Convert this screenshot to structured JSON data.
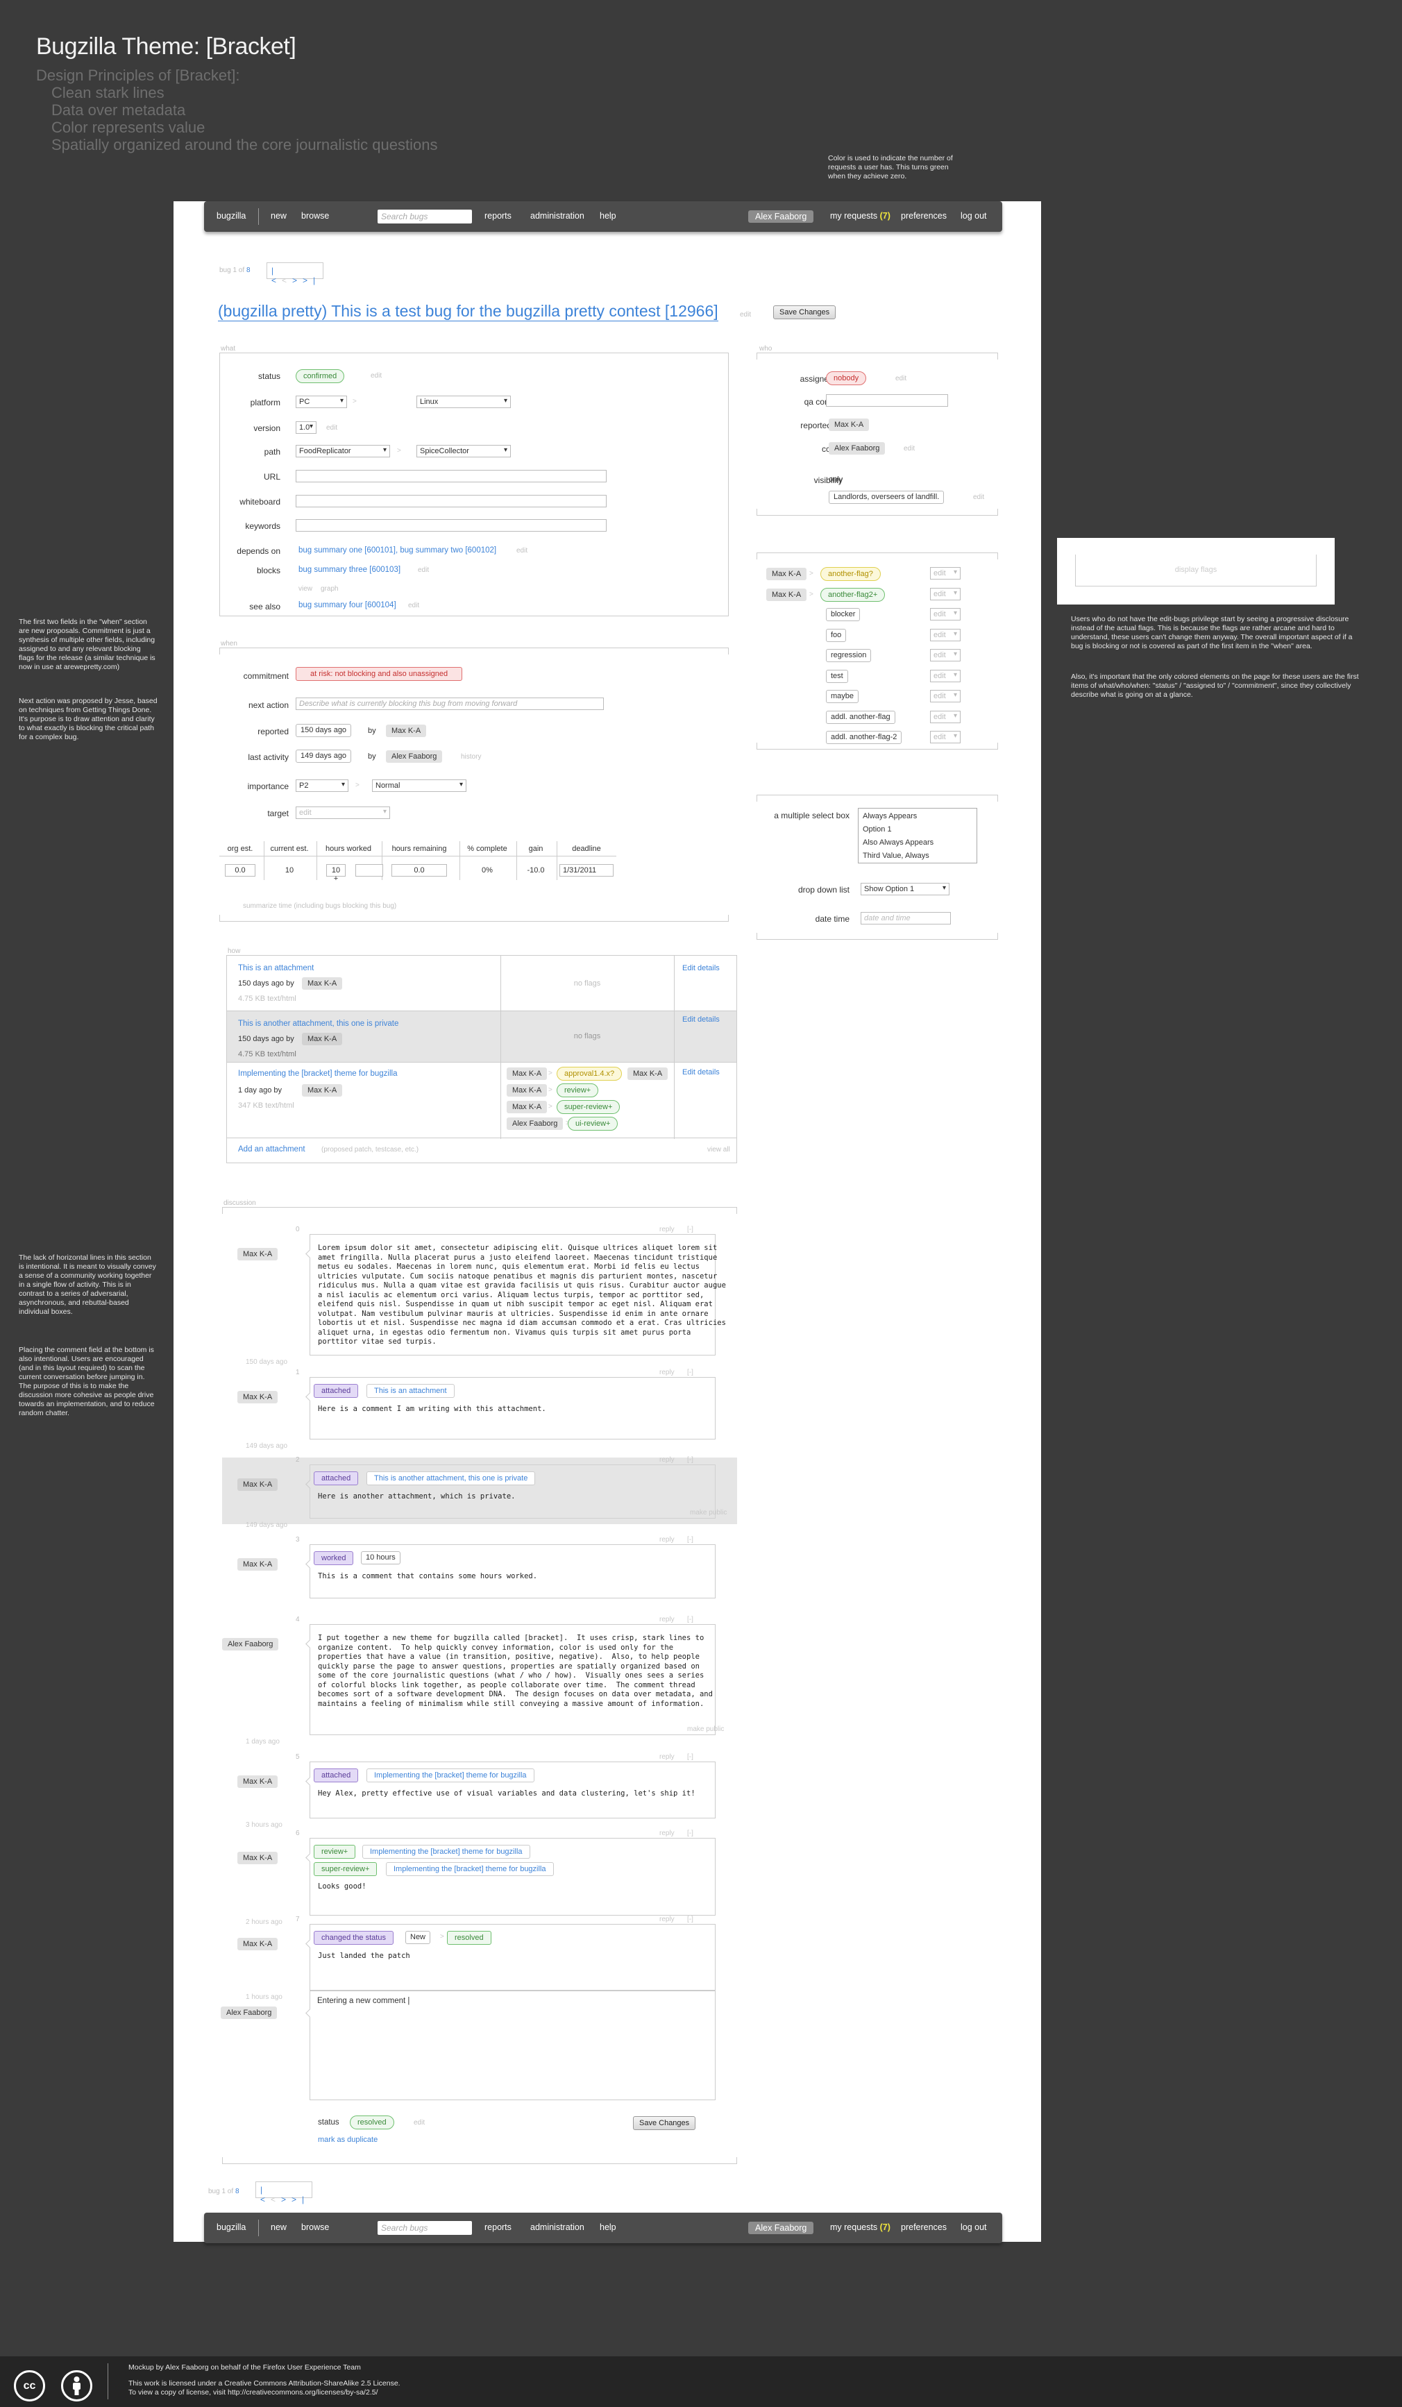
{
  "doc_title": "Bugzilla Theme: [Bracket]",
  "principles": {
    "heading": "Design Principles of [Bracket]:",
    "items": [
      "Clean stark lines",
      "Data over metadata",
      "Color represents value",
      "Spatially organized around the core journalistic questions"
    ]
  },
  "notes": {
    "requests": "Color is used to indicate the number of requests a user has. This turns green when they achieve zero.",
    "when_fields": "The first two fields in the \"when\" section are new proposals. Commitment is just a synthesis of multiple other fields, including assigned to and any relevant blocking flags for the release (a similar technique is now in use at arewepretty.com)",
    "next_action": "Next action was proposed by Jesse, based on techniques from Getting Things Done. It's purpose is to draw attention and clarity to what exactly is blocking the critical path for a complex bug.",
    "flags_1": "Users who do not have the edit-bugs privilege start by seeing a progressive disclosure instead of the actual flags. This is because the flags are rather arcane and hard to understand, these users can't change them anyway. The overall important aspect of if a bug is blocking or not is covered as part of the first item in the \"when\" area.",
    "flags_2": "Also, it's important that the only colored elements on the page for these users are the first items of what/who/when: \"status\" / \"assigned to\" / \"commitment\", since they collectively describe what is going on at a glance.",
    "discussion_1": "The lack of horizontal lines in this section is intentional. It is meant to visually convey a sense of a community working together in a single flow of activity. This is in contrast to a series of adversarial, asynchronous, and rebuttal-based individual boxes.",
    "discussion_2": "Placing the comment field at the bottom is also intentional. Users are encouraged (and in this layout required) to scan the current conversation before jumping in. The purpose of this is to make the discussion more cohesive as people drive towards an implementation, and to reduce random chatter."
  },
  "display_flags": "display flags",
  "nav": {
    "brand": "bugzilla",
    "new": "new",
    "browse": "browse",
    "search_placeholder": "Search bugs",
    "reports": "reports",
    "administration": "administration",
    "help": "help",
    "user": "Alex Faaborg",
    "my_requests": "my requests",
    "requests_count": "(7)",
    "preferences": "preferences",
    "logout": "log out"
  },
  "pager": {
    "label_prefix": "bug 1 of",
    "count": "8",
    "first": "|<",
    "prev": "<",
    "next": ">",
    "last": ">|"
  },
  "bug": {
    "title": "(bugzilla pretty) This is a test bug for the bugzilla pretty contest [12966]",
    "edit": "edit",
    "save": "Save Changes"
  },
  "what": {
    "label": "what",
    "status_label": "status",
    "status": "confirmed",
    "platform_label": "platform",
    "platform": "PC",
    "os": "Linux",
    "version_label": "version",
    "version": "1.0",
    "path_label": "path",
    "path_product": "FoodReplicator",
    "path_component": "SpiceCollector",
    "url_label": "URL",
    "whiteboard_label": "whiteboard",
    "keywords_label": "keywords",
    "depends_label": "depends on",
    "depends": "bug summary one [600101], bug summary two [600102]",
    "blocks_label": "blocks",
    "blocks": "bug summary three [600103]",
    "view": "view",
    "graph": "graph",
    "seealso_label": "see also",
    "seealso": "bug summary four [600104]"
  },
  "who": {
    "label": "who",
    "assigned_label": "assigned to",
    "assigned": "nobody",
    "qa_label": "qa contact",
    "reported_label": "reported by",
    "reported": "Max K-A",
    "cc_label": "cc list",
    "cc": "Alex Faaborg",
    "visibility_label": "visibility",
    "visibility_only": "only",
    "visibility": "Landlords, overseers of landfill."
  },
  "flags": [
    {
      "user": "Max K-A",
      "flag": "another-flag?",
      "color": "yellow",
      "value": "edit"
    },
    {
      "user": "Max K-A",
      "flag": "another-flag2+",
      "color": "green",
      "value": "edit"
    },
    {
      "user": "",
      "flag": "blocker",
      "color": "",
      "value": "edit"
    },
    {
      "user": "",
      "flag": "foo",
      "color": "",
      "value": "edit"
    },
    {
      "user": "",
      "flag": "regression",
      "color": "",
      "value": "edit"
    },
    {
      "user": "",
      "flag": "test",
      "color": "",
      "value": "edit"
    },
    {
      "user": "",
      "flag": "maybe",
      "color": "",
      "value": "edit"
    },
    {
      "user": "",
      "flag": "addl. another-flag",
      "color": "",
      "value": "edit"
    },
    {
      "user": "",
      "flag": "addl. another-flag-2",
      "color": "",
      "value": "edit"
    }
  ],
  "custom": {
    "multi_label": "a multiple select box",
    "multi_options": [
      "Always Appears",
      "Option 1",
      "Also Always Appears",
      "Third Value, Always"
    ],
    "dropdown_label": "drop down list",
    "dropdown": "Show Option 1",
    "datetime_label": "date time",
    "datetime_placeholder": "date and time"
  },
  "when": {
    "label": "when",
    "commitment_label": "commitment",
    "commitment": "at risk: not blocking and also unassigned",
    "next_label": "next action",
    "next_placeholder": "Describe what is currently blocking this bug from moving forward",
    "reported_label": "reported",
    "reported_ago": "150 days ago",
    "by": "by",
    "reported_by": "Max K-A",
    "activity_label": "last activity",
    "activity_ago": "149 days ago",
    "activity_by": "Alex Faaborg",
    "history": "history",
    "importance_label": "importance",
    "priority": "P2",
    "severity": "Normal",
    "target_label": "target",
    "target": "edit",
    "time_headers": [
      "org est.",
      "current est.",
      "hours worked",
      "hours remaining",
      "% complete",
      "gain",
      "deadline"
    ],
    "time_values": [
      "0.0",
      "10",
      "10 +",
      "0.0",
      "0%",
      "-10.0",
      "1/31/2011"
    ],
    "summarize": "summarize time (including bugs blocking this bug)"
  },
  "how": {
    "label": "how",
    "attachments": [
      {
        "title": "This is an attachment",
        "ago": "150 days ago by",
        "user": "Max K-A",
        "size": "4.75 KB text/html",
        "flags": "no flags",
        "edit": "Edit details"
      },
      {
        "title": "This is another attachment, this one is private",
        "ago": "150 days ago by",
        "user": "Max K-A",
        "size": "4.75 KB text/html",
        "flags": "no flags",
        "edit": "Edit details"
      },
      {
        "title": "Implementing the [bracket] theme for bugzilla",
        "ago": "1 day ago by",
        "user": "Max K-A",
        "size": "347 KB text/html",
        "edit": "Edit details"
      }
    ],
    "att3_flags": [
      {
        "user": "Max K-A",
        "flag": "approval1.4.x?",
        "color": "yellow",
        "user2": "Max K-A"
      },
      {
        "user": "Max K-A",
        "flag": "review+",
        "color": "green"
      },
      {
        "user": "Max K-A",
        "flag": "super-review+",
        "color": "green"
      },
      {
        "user": "Alex Faaborg",
        "flag": "ui-review+",
        "color": "green"
      }
    ],
    "add": "Add an attachment",
    "add_hint": "(proposed patch, testcase, etc.)",
    "view_all": "view all"
  },
  "discussion": {
    "label": "discussion",
    "reply": "reply",
    "collapse": "[-]",
    "make_private": "make public",
    "comments": [
      {
        "num": "0",
        "user": "Max K-A",
        "ago": "150 days ago",
        "text": "Lorem ipsum dolor sit amet, consectetur adipiscing elit. Quisque ultrices aliquet lorem sit\namet fringilla. Nulla placerat purus a justo eleifend laoreet. Maecenas tincidunt tristique\nmetus eu sodales. Maecenas in lorem nunc, quis elementum erat. Morbi id felis eu lectus\nultricies vulputate. Cum sociis natoque penatibus et magnis dis parturient montes, nascetur\nridiculus mus. Nulla a quam vitae est gravida facilisis ut quis risus. Curabitur auctor augue\na nisl iaculis ac elementum orci varius. Aliquam lectus turpis, tempor ac porttitor sed,\neleifend quis nisl. Suspendisse in quam ut nibh suscipit tempor ac eget nisl. Aliquam erat\nvolutpat. Nam vestibulum pulvinar mauris at ultricies. Suspendisse id enim in ante ornare\nlobortis ut et nisl. Suspendisse nec magna id diam accumsan commodo et a erat. Cras ultricies\naliquet urna, in egestas odio fermentum non. Vivamus quis turpis sit amet purus porta\nporttitor vitae sed turpis."
      },
      {
        "num": "1",
        "user": "Max K-A",
        "ago": "149 days ago",
        "tag": "attached",
        "tag_value": "This is an attachment",
        "text": "Here is a comment I am writing with this attachment."
      },
      {
        "num": "2",
        "user": "Max K-A",
        "ago": "149 days ago",
        "tag": "attached",
        "tag_value": "This is another attachment, this one is private",
        "text": "Here is another attachment, which is private."
      },
      {
        "num": "3",
        "user": "Max K-A",
        "ago": "",
        "tag": "worked",
        "tag_value": "10 hours",
        "text": "This is a comment that contains some hours worked."
      },
      {
        "num": "4",
        "user": "Alex Faaborg",
        "ago": "1 days ago",
        "text": "I put together a new theme for bugzilla called [bracket].  It uses crisp, stark lines to\norganize content.  To help quickly convey information, color is used only for the\nproperties that have a value (in transition, positive, negative).  Also, to help people\nquickly parse the page to answer questions, properties are spatially organized based on\nsome of the core journalistic questions (what / who / how).  Visually ones sees a series\nof colorful blocks link together, as people collaborate over time.  The comment thread\nbecomes sort of a software development DNA.  The design focuses on data over metadata, and\nmaintains a feeling of minimalism while still conveying a massive amount of information."
      },
      {
        "num": "5",
        "user": "Max K-A",
        "ago": "3 hours ago",
        "tag": "attached",
        "tag_value": "Implementing the [bracket] theme for bugzilla",
        "text": "Hey Alex, pretty effective use of visual variables and data clustering, let's ship it!"
      },
      {
        "num": "6",
        "user": "Max K-A",
        "ago": "2 hours ago",
        "tag": "review+",
        "tag_value": "Implementing the [bracket] theme for bugzilla",
        "tag2": "super-review+",
        "tag2_value": "Implementing the [bracket] theme for bugzilla",
        "text": "Looks good!"
      },
      {
        "num": "7",
        "user": "Max K-A",
        "ago": "1 hours ago",
        "tag": "changed the status",
        "tag_from": "New",
        "tag_to": "resolved",
        "text": "Just landed the patch"
      }
    ],
    "new_user": "Alex Faaborg",
    "new_text": "Entering a new comment |",
    "status_label": "status",
    "status": "resolved",
    "status_edit": "edit",
    "duplicate": "mark as duplicate",
    "save": "Save Changes"
  },
  "footer": {
    "cc_logo": "cc",
    "line1": "Mockup by Alex Faaborg on behalf of the Firefox User Experience Team",
    "line2": "This work is licensed under a Creative Commons Attribution-ShareAlike 2.5 License.",
    "line3": "To view a copy of license, visit http://creativecommons.org/licenses/by-sa/2.5/"
  }
}
